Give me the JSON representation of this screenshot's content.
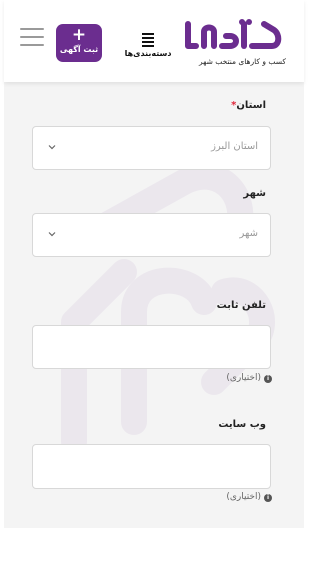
{
  "header": {
    "add_ad_plus": "+",
    "add_ad_label": "ثبت آگهی",
    "categories_label": "دسته‌بندی‌ها",
    "logo_tagline": "کسب و کارهای منتخب شهر",
    "brand_color": "#6b2d8f"
  },
  "form": {
    "province": {
      "label": "استان",
      "required_mark": "*",
      "value": "استان البرز"
    },
    "city": {
      "label": "شهر",
      "placeholder": "شهر"
    },
    "phone": {
      "label": "تلفن ثابت",
      "hint": "(اختیاری)"
    },
    "website": {
      "label": "وب سایت",
      "hint": "(اختیاری)"
    }
  },
  "icons": {
    "menu": "hamburger-icon",
    "categories": "list-icon",
    "chevron": "chevron-down-icon",
    "info": "info-icon"
  }
}
